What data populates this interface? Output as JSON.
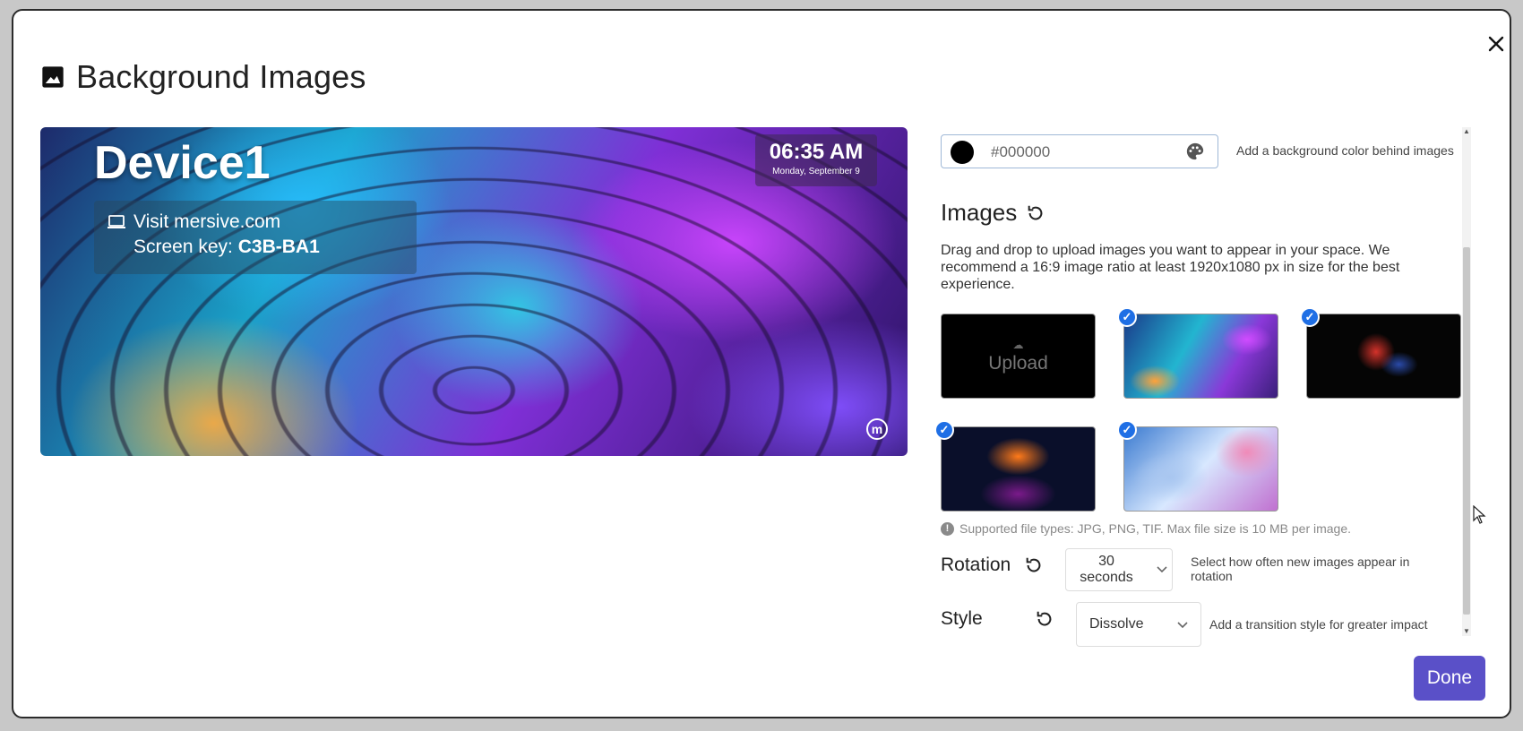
{
  "dialog": {
    "title": "Background Images",
    "close_label": "×",
    "done_label": "Done"
  },
  "preview": {
    "device_name": "Device1",
    "visit_text": "Visit mersive.com",
    "screen_key_label": "Screen key:",
    "screen_key_value": "C3B-BA1",
    "clock_time": "06:35 AM",
    "clock_date": "Monday, September 9",
    "logo_letter": "m"
  },
  "background_color": {
    "value": "#000000",
    "swatch_color": "#000000",
    "help": "Add a background color behind images"
  },
  "images": {
    "heading": "Images",
    "description": "Drag and drop to upload images you want to appear in your space. We recommend a 16:9 image ratio at least 1920x1080 px in size for the best experience.",
    "upload_label": "Upload",
    "thumbnails": [
      {
        "name": "iridescent-scales",
        "selected": true
      },
      {
        "name": "betta-fish",
        "selected": true
      },
      {
        "name": "orange-flower",
        "selected": true
      },
      {
        "name": "pastel-petals",
        "selected": true
      }
    ],
    "filetypes_note": "Supported file types: JPG, PNG, TIF. Max file size is 10 MB per image."
  },
  "rotation": {
    "label": "Rotation",
    "value_line1": "30",
    "value_line2": "seconds",
    "help": "Select how often new images appear in rotation"
  },
  "style": {
    "label": "Style",
    "value": "Dissolve",
    "help": "Add a transition style for greater impact"
  },
  "colors": {
    "accent": "#5a50c8",
    "check": "#1f6fe5"
  }
}
